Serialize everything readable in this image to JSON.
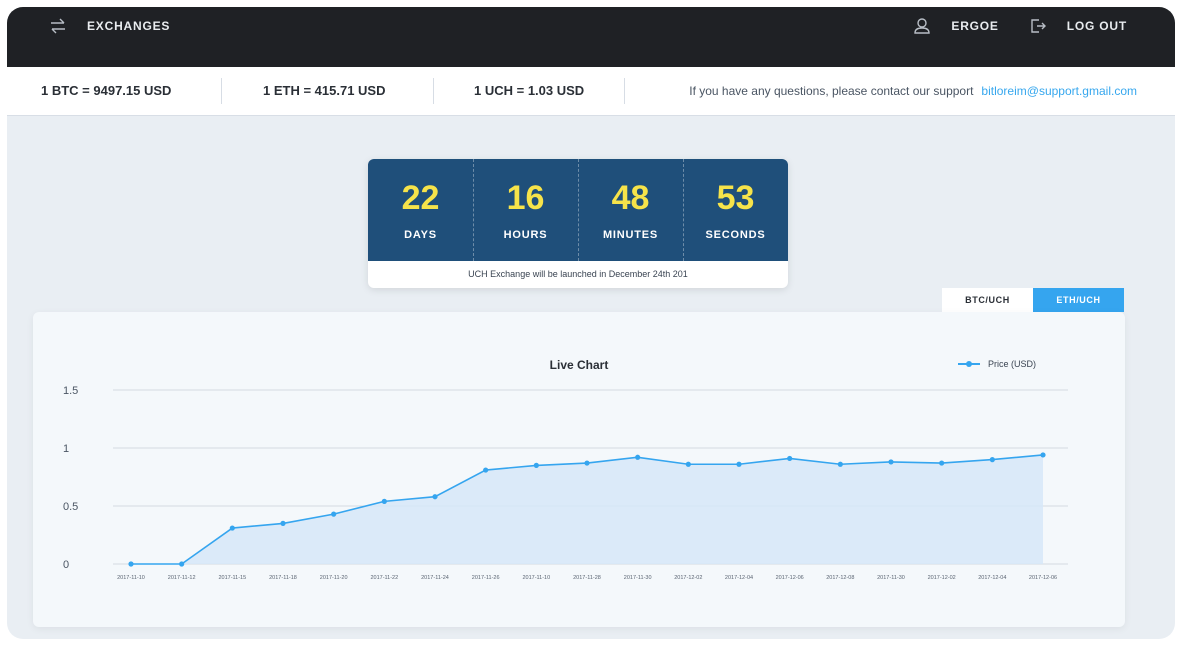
{
  "nav": {
    "exchanges_label": "EXCHANGES",
    "user_label": "ERGOE",
    "logout_label": "LOG OUT"
  },
  "rates": {
    "btc": "1 BTC = 9497.15 USD",
    "eth": "1 ETH = 415.71 USD",
    "uch": "1 UCH = 1.03 USD"
  },
  "support": {
    "text": "If you have any questions, please contact our support",
    "email": "bitloreim@support.gmail.com"
  },
  "countdown": {
    "units": [
      {
        "value": "22",
        "label": "DAYS"
      },
      {
        "value": "16",
        "label": "HOURS"
      },
      {
        "value": "48",
        "label": "MINUTES"
      },
      {
        "value": "53",
        "label": "SECONDS"
      }
    ],
    "note": "UCH Exchange will be launched in December 24th 201"
  },
  "pair_tabs": [
    {
      "label": "BTC/UCH",
      "active": false
    },
    {
      "label": "ETH/UCH",
      "active": true
    }
  ],
  "colors": {
    "accent": "#35a5ef",
    "countdown_bg": "#1f4f7a",
    "countdown_digits": "#f6e34a",
    "topbar_bg": "#1f2125"
  },
  "chart_data": {
    "type": "area",
    "title": "Live Chart",
    "legend_position": "top-right",
    "grid": true,
    "ylim": [
      0,
      1.5
    ],
    "y_ticks": [
      "0",
      "0.5",
      "1",
      "1.5"
    ],
    "categories": [
      "2017-11-10",
      "2017-11-12",
      "2017-11-15",
      "2017-11-18",
      "2017-11-20",
      "2017-11-22",
      "2017-11-24",
      "2017-11-26",
      "2017-11-10",
      "2017-11-28",
      "2017-11-30",
      "2017-12-02",
      "2017-12-04",
      "2017-12-06",
      "2017-12-08",
      "2017-11-30",
      "2017-12-02",
      "2017-12-04",
      "2017-12-06"
    ],
    "series": [
      {
        "name": "Price (USD)",
        "values": [
          0,
          0,
          0.31,
          0.35,
          0.43,
          0.54,
          0.58,
          0.81,
          0.85,
          0.87,
          0.92,
          0.86,
          0.86,
          0.91,
          0.86,
          0.88,
          0.87,
          0.9,
          0.94
        ]
      }
    ]
  }
}
